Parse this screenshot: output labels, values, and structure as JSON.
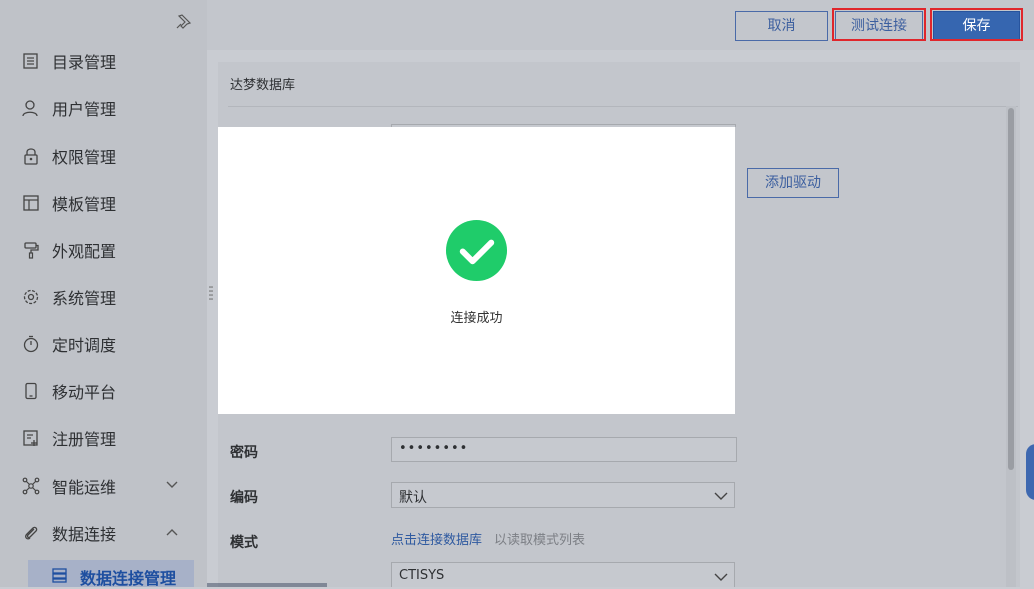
{
  "sidebar": {
    "items": [
      {
        "label": "目录管理",
        "icon": "catalog-icon"
      },
      {
        "label": "用户管理",
        "icon": "user-icon"
      },
      {
        "label": "权限管理",
        "icon": "lock-icon"
      },
      {
        "label": "模板管理",
        "icon": "template-icon"
      },
      {
        "label": "外观配置",
        "icon": "paint-roller-icon"
      },
      {
        "label": "系统管理",
        "icon": "gear-icon"
      },
      {
        "label": "定时调度",
        "icon": "timer-icon"
      },
      {
        "label": "移动平台",
        "icon": "mobile-icon"
      },
      {
        "label": "注册管理",
        "icon": "register-icon"
      },
      {
        "label": "智能运维",
        "icon": "network-icon",
        "expanded": false
      },
      {
        "label": "数据连接",
        "icon": "paperclip-icon",
        "expanded": true
      }
    ],
    "sub_item": {
      "label": "数据连接管理",
      "icon": "database-icon"
    }
  },
  "toolbar": {
    "cancel_label": "取消",
    "test_label": "测试连接",
    "save_label": "保存"
  },
  "panel": {
    "title": "达梦数据库",
    "add_driver_label": "添加驱动",
    "password_label": "密码",
    "password_value": "••••••••",
    "encoding_label": "编码",
    "encoding_value": "默认",
    "mode_label": "模式",
    "mode_link": "点击连接数据库",
    "mode_hint": "以读取模式列表",
    "schema_value": "CTISYS"
  },
  "modal": {
    "icon": "check-circle-icon",
    "message": "连接成功"
  },
  "colors": {
    "accent": "#3666b0",
    "success": "#1fcc6a",
    "highlight": "#e0262b"
  }
}
